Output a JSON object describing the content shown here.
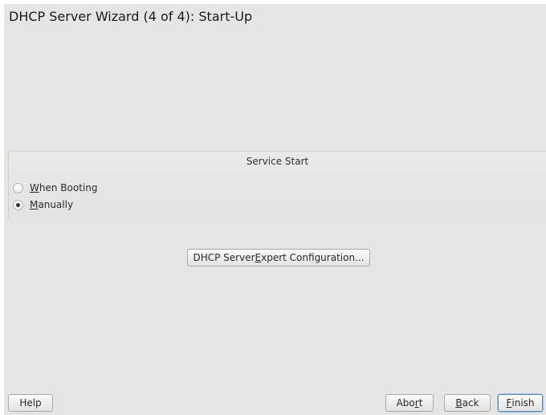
{
  "wizard": {
    "title": "DHCP Server Wizard (4 of 4): Start-Up"
  },
  "service_start": {
    "title": "Service Start",
    "options": [
      {
        "pre": "",
        "key": "W",
        "post": "hen Booting",
        "checked": false
      },
      {
        "pre": "",
        "key": "M",
        "post": "anually",
        "checked": true
      }
    ]
  },
  "expert_button": {
    "pre": "DHCP Server ",
    "key": "E",
    "post": "xpert Configuration..."
  },
  "footer": {
    "help": "Help",
    "abort": {
      "pre": "Abo",
      "key": "r",
      "post": "t"
    },
    "back": {
      "pre": "",
      "key": "B",
      "post": "ack"
    },
    "finish": {
      "pre": "",
      "key": "F",
      "post": "inish"
    }
  }
}
